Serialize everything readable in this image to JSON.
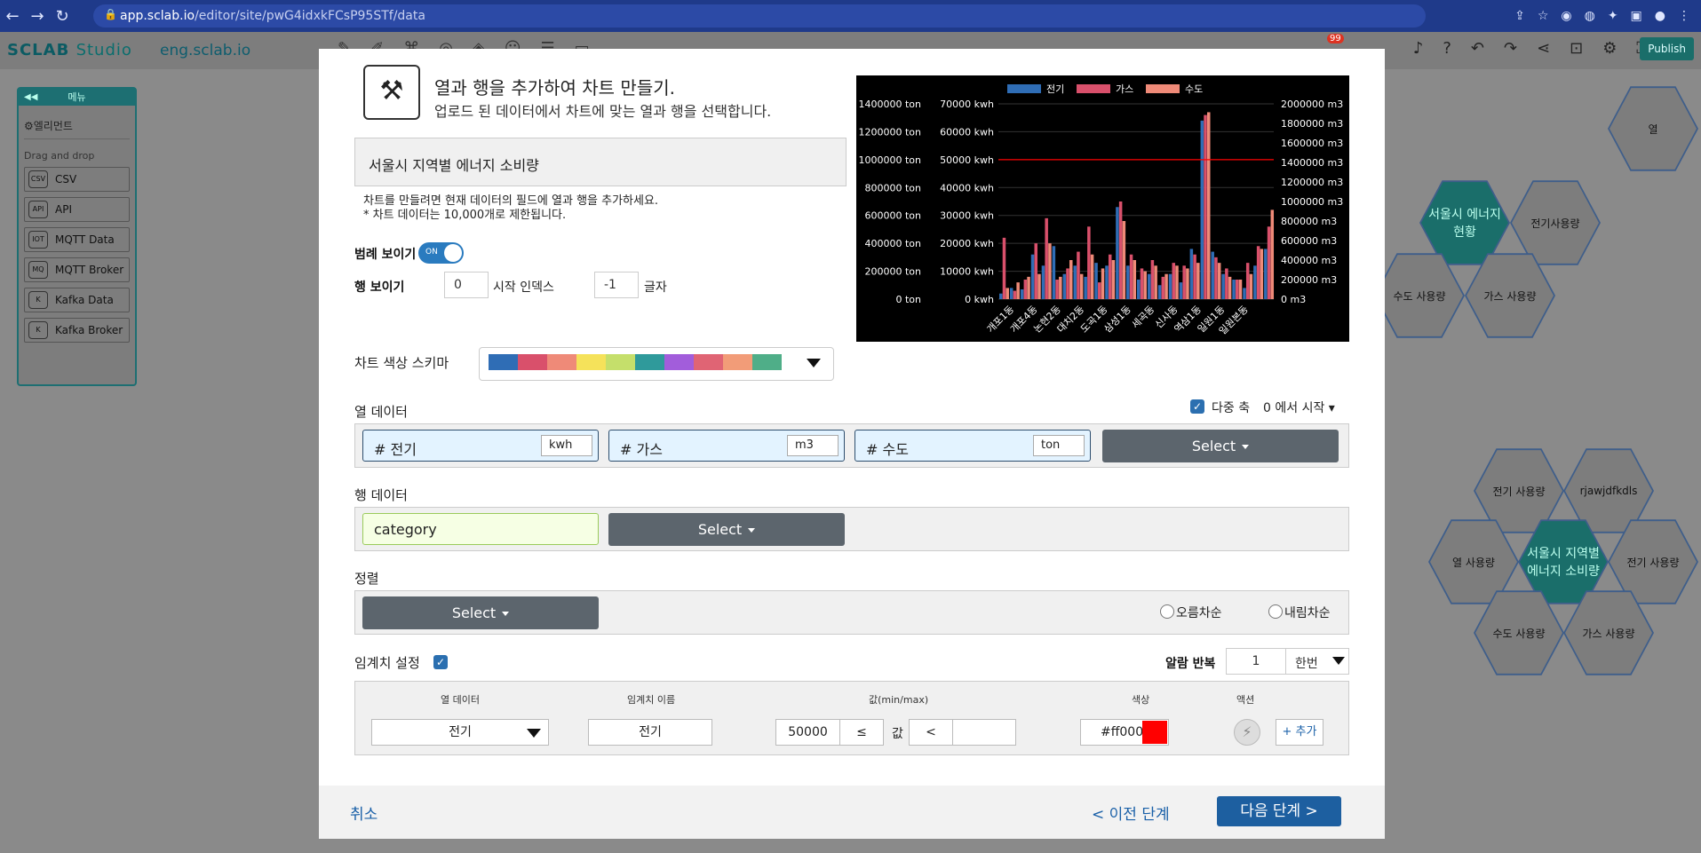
{
  "browser": {
    "url_host": "app.sclab.io",
    "url_path": "/editor/site/pwG4idxkFCsP95STf/data"
  },
  "app": {
    "logo": "SCLAB",
    "logo_studio": "Studio",
    "site_name": "eng.sclab.io",
    "notification_count": "99",
    "publish_label": "Publish"
  },
  "sidebar": {
    "title": "메뉴",
    "element_label": "엘리먼트",
    "drag_label": "Drag and drop",
    "items": [
      {
        "icon": "CSV",
        "label": "CSV"
      },
      {
        "icon": "API",
        "label": "API"
      },
      {
        "icon": "IOT",
        "label": "MQTT Data"
      },
      {
        "icon": "MQ",
        "label": "MQTT Broker"
      },
      {
        "icon": "K",
        "label": "Kafka Data"
      },
      {
        "icon": "K",
        "label": "Kafka Broker"
      }
    ]
  },
  "canvas_hexes": [
    "열",
    "서울시 에너지 현황",
    "전기사용량",
    "수도 사용량",
    "가스 사용량",
    "전기 사용량",
    "rjawjdfkdls",
    "열 사용량",
    "서울시 지역별 에너지 소비량",
    "전기 사용량",
    "수도 사용량",
    "가스 사용량"
  ],
  "modal": {
    "title": "열과 행을 추가하여 차트 만들기.",
    "subtitle": "업로드 된 데이터에서 차트에 맞는 열과 행을 선택합니다.",
    "dataset_name": "서울시 지역별 에너지 소비량",
    "hint_line1": "차트를 만들려면 현재 데이터의 필드에 열과 행을 추가하세요.",
    "hint_line2": "* 차트 데이터는 10,000개로 제한됩니다.",
    "legend_label": "범례 보이기",
    "legend_toggle": "ON",
    "rows_label": "행 보이기",
    "rows_start": "0",
    "rows_start_label": "시작 인덱스",
    "rows_len": "-1",
    "rows_len_label": "글자",
    "palette_label": "차트 색상 스키마",
    "palette_colors": [
      "#2f6db5",
      "#d9506b",
      "#ef8a78",
      "#f5e25a",
      "#c5df6b",
      "#2f9a9b",
      "#a25ddb",
      "#e06474",
      "#f29c78",
      "#4fae88"
    ],
    "col_label": "열 데이터",
    "multi_axis_label": "다중 축",
    "start_from_label": "0 에서 시작",
    "columns": [
      {
        "name": "# 전기",
        "unit": "kwh"
      },
      {
        "name": "# 가스",
        "unit": "m3"
      },
      {
        "name": "# 수도",
        "unit": "ton"
      }
    ],
    "select_label": "Select",
    "row_label": "행 데이터",
    "row_field": "category",
    "sort_label": "정렬",
    "sort_asc": "오름차순",
    "sort_desc": "내림차순",
    "threshold_label": "임계치 설정",
    "alarm_label": "알람 반복",
    "alarm_value": "1",
    "alarm_mode": "한번",
    "thr_headers": {
      "col": "열 데이터",
      "name": "임계치 이름",
      "value": "값(min/max)",
      "color": "색상",
      "action": "액션"
    },
    "thr_row": {
      "col": "전기",
      "name": "전기",
      "min": "50000",
      "op1": "≤",
      "val_label": "값",
      "op2": "<",
      "max": "",
      "color": "#ff0000",
      "add": "+ 추가"
    },
    "cancel": "취소",
    "prev": "< 이전 단계",
    "next": "다음 단계 >"
  },
  "chart_data": {
    "type": "bar",
    "legend": [
      "전기",
      "가스",
      "수도"
    ],
    "colors": [
      "#2f6db5",
      "#d9506b",
      "#ef8a78"
    ],
    "categories": [
      "개포1동",
      "개포4동",
      "논현2동",
      "대치2동",
      "도곡1동",
      "삼성1동",
      "세곡동",
      "신사동",
      "역삼1동",
      "일원1동",
      "일원본동"
    ],
    "y_left1_ticks": [
      "1400000 ton",
      "1200000 ton",
      "1000000 ton",
      "800000 ton",
      "600000 ton",
      "400000 ton",
      "200000 ton",
      "0 ton"
    ],
    "y_left2_ticks": [
      "70000 kwh",
      "60000 kwh",
      "50000 kwh",
      "40000 kwh",
      "30000 kwh",
      "20000 kwh",
      "10000 kwh",
      "0 kwh"
    ],
    "y_right_ticks": [
      "2000000 m3",
      "1800000 m3",
      "1600000 m3",
      "1400000 m3",
      "1200000 m3",
      "1000000 m3",
      "800000 m3",
      "600000 m3",
      "400000 m3",
      "200000 m3",
      "0 m3"
    ],
    "threshold_line": 50000,
    "series": [
      {
        "name": "전기",
        "values": [
          2000,
          4000,
          3500,
          16000,
          12000,
          19000,
          9000,
          12000,
          8000,
          13000,
          12000,
          33000,
          12000,
          7000,
          9000,
          5000,
          9000,
          6000,
          18000,
          64000,
          17000,
          9000,
          7000,
          4000,
          12000,
          18000
        ]
      },
      {
        "name": "가스",
        "values": [
          22000,
          3000,
          7000,
          20000,
          29000,
          7000,
          11000,
          17000,
          26000,
          6000,
          16000,
          35000,
          16000,
          11000,
          14000,
          8000,
          13000,
          12000,
          16000,
          66000,
          15000,
          11000,
          7000,
          13000,
          19000,
          26000
        ]
      },
      {
        "name": "수도",
        "values": [
          4000,
          6000,
          8000,
          9000,
          20000,
          8000,
          14000,
          9000,
          16000,
          11000,
          14000,
          28000,
          14000,
          10000,
          12000,
          9000,
          12000,
          11000,
          13000,
          67000,
          13000,
          8000,
          7000,
          9000,
          18000,
          32000
        ]
      }
    ]
  }
}
